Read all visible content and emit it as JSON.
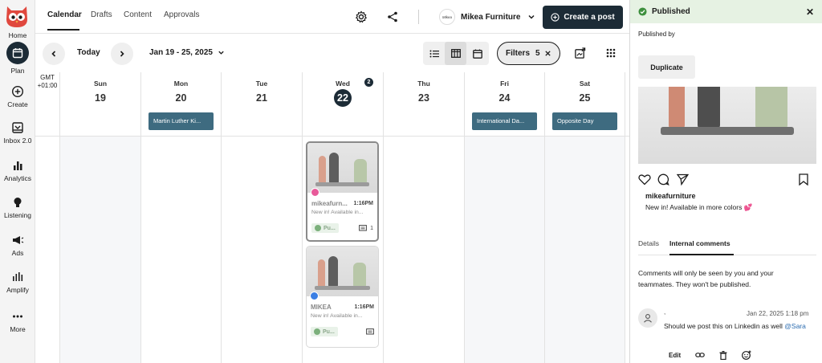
{
  "nav": {
    "items": [
      {
        "label": "Home"
      },
      {
        "label": "Plan"
      },
      {
        "label": "Create"
      },
      {
        "label": "Inbox 2.0"
      },
      {
        "label": "Analytics"
      },
      {
        "label": "Listening"
      },
      {
        "label": "Ads"
      },
      {
        "label": "Amplify"
      },
      {
        "label": "More"
      }
    ]
  },
  "header": {
    "tabs": [
      "Calendar",
      "Drafts",
      "Content",
      "Approvals"
    ],
    "account": {
      "logo_text": "Mikea",
      "name": "Mikea Furniture"
    },
    "create_label": "Create a post"
  },
  "toolbar": {
    "today_label": "Today",
    "date_range": "Jan 19 - 25, 2025",
    "filters_label": "Filters",
    "filters_count": "5"
  },
  "calendar": {
    "timezone_line1": "GMT",
    "timezone_line2": "+01:00",
    "days": [
      {
        "name": "Sun",
        "num": "19"
      },
      {
        "name": "Mon",
        "num": "20",
        "holiday": "Martin Luther Ki..."
      },
      {
        "name": "Tue",
        "num": "21"
      },
      {
        "name": "Wed",
        "num": "22",
        "badge": "2"
      },
      {
        "name": "Thu",
        "num": "23"
      },
      {
        "name": "Fri",
        "num": "24",
        "holiday": "International Da..."
      },
      {
        "name": "Sat",
        "num": "25",
        "holiday": "Opposite Day"
      }
    ],
    "posts": [
      {
        "name": "mikeafurn...",
        "time": "1:16PM",
        "text": "New in! Available in...",
        "status": "Pu...",
        "comments": "1"
      },
      {
        "name": "MIKEA",
        "time": "1:16PM",
        "text": "New in! Available in...",
        "status": "Pu...",
        "comments": ""
      }
    ]
  },
  "panel": {
    "title": "Published",
    "published_by": "Published by",
    "duplicate_label": "Duplicate",
    "username": "mikeafurniture",
    "caption": "New in! Available in more colors 💕",
    "tabs": [
      "Details",
      "Internal comments"
    ],
    "comments_note": "Comments will only be seen by you and your teammates. They won't be published.",
    "comment": {
      "author": ",",
      "date": "Jan 22, 2025 1:18 pm",
      "text": "Should we post this on Linkedin as well ",
      "mention": "@Sara",
      "edit_label": "Edit"
    }
  },
  "colors": {
    "brand_dark": "#1c2b36",
    "holiday": "#3e6b80",
    "published_bg": "#e6f2e3",
    "logo_red": "#e0483e"
  }
}
